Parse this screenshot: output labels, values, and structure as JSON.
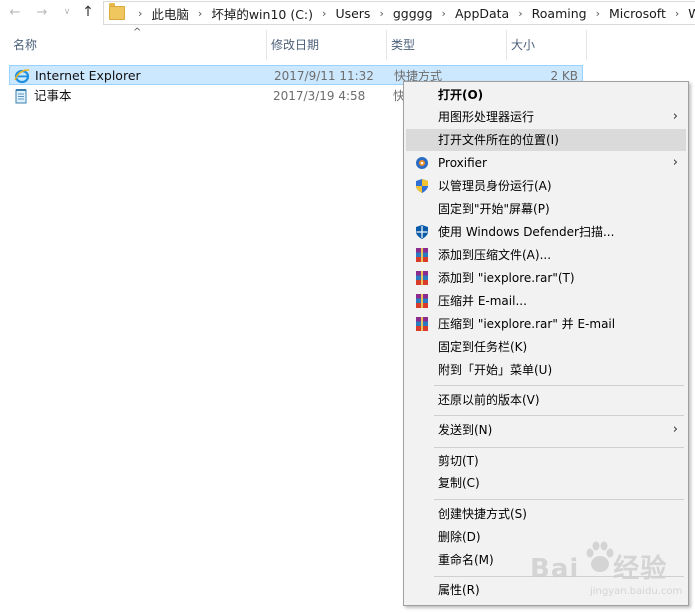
{
  "address_bar": {
    "crumbs": [
      "此电脑",
      "坏掉的win10 (C:)",
      "Users",
      "ggggg",
      "AppData",
      "Roaming",
      "Microsoft",
      "Wi"
    ]
  },
  "columns": {
    "name": "名称",
    "date": "修改日期",
    "type": "类型",
    "size": "大小"
  },
  "files": [
    {
      "name": "Internet Explorer",
      "date": "2017/9/11 11:32",
      "type": "快捷方式",
      "size": "2 KB",
      "icon": "internet-explorer-icon"
    },
    {
      "name": "记事本",
      "date": "2017/3/19 4:58",
      "type": "快",
      "size": "",
      "icon": "notepad-icon"
    }
  ],
  "context_menu": {
    "items": [
      {
        "label": "打开(O)"
      },
      {
        "label": "用图形处理器运行"
      },
      {
        "label": "打开文件所在的位置(I)"
      },
      {
        "label": "Proxifier"
      },
      {
        "label": "以管理员身份运行(A)"
      },
      {
        "label": "固定到\"开始\"屏幕(P)"
      },
      {
        "label": "使用 Windows Defender扫描..."
      },
      {
        "label": "添加到压缩文件(A)..."
      },
      {
        "label": "添加到 \"iexplore.rar\"(T)"
      },
      {
        "label": "压缩并 E-mail..."
      },
      {
        "label": "压缩到 \"iexplore.rar\" 并 E-mail"
      },
      {
        "label": "固定到任务栏(K)"
      },
      {
        "label": "附到「开始」菜单(U)"
      },
      {
        "label": "还原以前的版本(V)"
      },
      {
        "label": "发送到(N)"
      },
      {
        "label": "剪切(T)"
      },
      {
        "label": "复制(C)"
      },
      {
        "label": "创建快捷方式(S)"
      },
      {
        "label": "删除(D)"
      },
      {
        "label": "重命名(M)"
      },
      {
        "label": "属性(R)"
      }
    ]
  },
  "watermark": {
    "brand": "Bai",
    "brand2": "经验",
    "sub": "jingyan.baidu.com"
  },
  "colors": {
    "selection": "#cce8ff",
    "menu_bg": "#f2f2f2",
    "menu_hover": "#dadada",
    "header_text": "#4c607a"
  }
}
